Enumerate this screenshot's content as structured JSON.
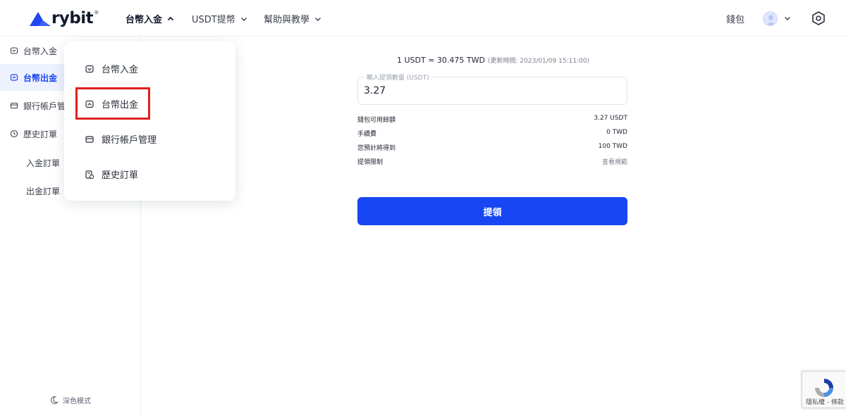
{
  "header": {
    "logo_text": "rybit",
    "logo_reg": "®",
    "nav": [
      {
        "label": "台幣入金",
        "active": true
      },
      {
        "label": "USDT提幣",
        "active": false
      },
      {
        "label": "幫助與教學",
        "active": false
      }
    ],
    "wallet_label": "錢包"
  },
  "sidebar": {
    "items": [
      {
        "label": "台幣入金",
        "icon": "deposit-icon"
      },
      {
        "label": "台幣出金",
        "icon": "withdraw-icon",
        "active": true
      },
      {
        "label": "銀行帳戶管",
        "icon": "card-icon"
      },
      {
        "label": "歷史訂單",
        "icon": "clock-icon"
      }
    ],
    "sub_items": [
      "入金訂單",
      "出金訂單"
    ],
    "dark_mode_label": "深色模式"
  },
  "dropdown": {
    "items": [
      {
        "label": "台幣入金",
        "icon": "deposit-icon"
      },
      {
        "label": "台幣出金",
        "icon": "withdraw-icon"
      },
      {
        "label": "銀行帳戶管理",
        "icon": "card-icon"
      },
      {
        "label": "歷史訂單",
        "icon": "order-history-icon"
      }
    ]
  },
  "main": {
    "rate_text": "1 USDT ≈ 30.475 TWD",
    "rate_updated": "(更新時間: 2023/01/09 15:11:00)",
    "amount_label": "輸入提領數量 (USDT)",
    "amount_value": "3.27",
    "info": [
      {
        "label": "錢包可用餘額",
        "value": "3.27 USDT"
      },
      {
        "label": "手續費",
        "value": "0 TWD"
      },
      {
        "label": "您預計將得到",
        "value": "100 TWD"
      },
      {
        "label": "提領限制",
        "value": "查看規範"
      }
    ],
    "submit_label": "提領"
  },
  "recaptcha": {
    "text": "隱私權 - 條款"
  },
  "colors": {
    "accent": "#1746f2",
    "highlight_border": "#e0201e",
    "active_bg": "#eef2ff"
  }
}
